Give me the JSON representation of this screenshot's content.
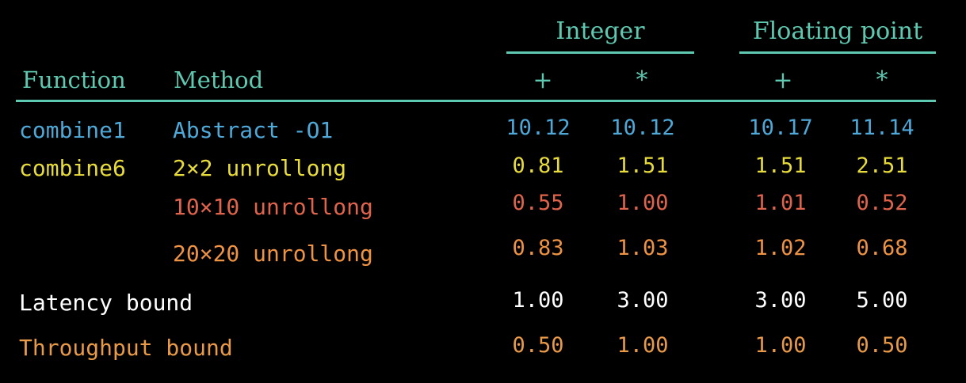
{
  "header": {
    "groups": [
      {
        "label": "Integer"
      },
      {
        "label": "Floating point"
      }
    ],
    "columns": {
      "function": "Function",
      "method": "Method"
    },
    "ops": [
      "+",
      "*",
      "+",
      "*"
    ]
  },
  "rows": [
    {
      "function": "combine1",
      "method": "Abstract -O1",
      "values": [
        "10.12",
        "10.12",
        "10.17",
        "11.14"
      ],
      "color": "#4ea8d8"
    },
    {
      "function": "combine6",
      "method": "2×2 unrollong",
      "values": [
        "0.81",
        "1.51",
        "1.51",
        "2.51"
      ],
      "color": "#e8dc3c"
    },
    {
      "function": "",
      "method": "10×10 unrollong",
      "values": [
        "0.55",
        "1.00",
        "1.01",
        "0.52"
      ],
      "color": "#e0644c"
    },
    {
      "function": "",
      "method": "20×20 unrollong",
      "values": [
        "0.83",
        "1.03",
        "1.02",
        "0.68"
      ],
      "color": "#ee9244"
    },
    {
      "function": "Latency bound",
      "method": "",
      "values": [
        "1.00",
        "3.00",
        "3.00",
        "5.00"
      ],
      "color": "#ffffff"
    },
    {
      "function": "Throughput bound",
      "method": "",
      "values": [
        "0.50",
        "1.00",
        "1.00",
        "0.50"
      ],
      "color": "#e89a48"
    }
  ]
}
